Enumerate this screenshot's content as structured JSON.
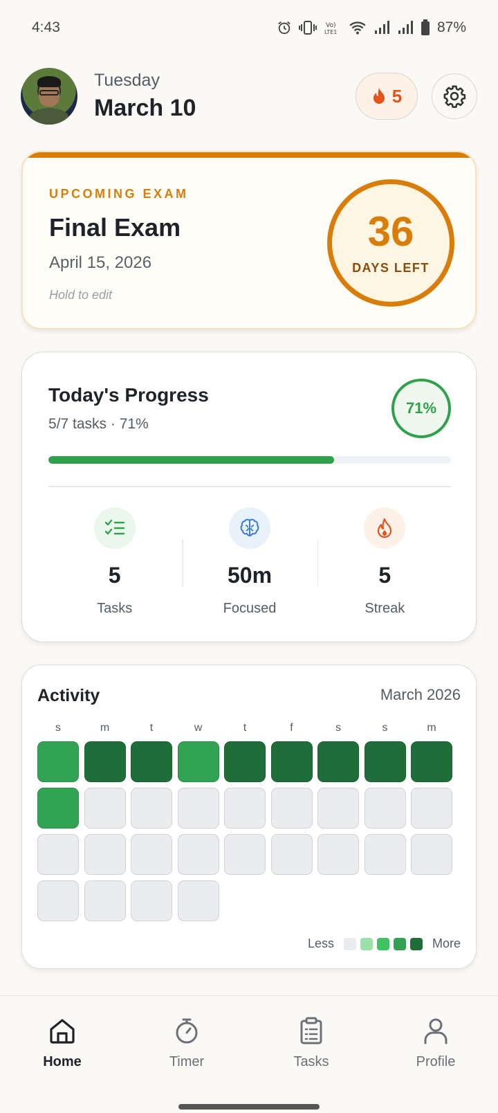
{
  "status_bar": {
    "time": "4:43",
    "battery": "87%",
    "icons": [
      "alarm-icon",
      "vibrate-icon",
      "volte-icon",
      "wifi-icon",
      "signal-icon",
      "signal-icon",
      "battery-icon"
    ]
  },
  "header": {
    "weekday": "Tuesday",
    "date": "March 10",
    "streak_count": "5",
    "streak_icon": "flame-icon",
    "settings_icon": "gear-icon"
  },
  "exam": {
    "label": "UPCOMING EXAM",
    "title": "Final Exam",
    "date": "April 15, 2026",
    "hint": "Hold to edit",
    "days_left": "36",
    "days_label": "DAYS LEFT",
    "accent": "#d97d0a"
  },
  "progress": {
    "title": "Today's Progress",
    "subtitle": "5/7 tasks · 71%",
    "percent_label": "71%",
    "percent": 71,
    "accent": "#2fa14a",
    "stats": [
      {
        "value": "5",
        "label": "Tasks",
        "icon": "checklist-icon"
      },
      {
        "value": "50m",
        "label": "Focused",
        "icon": "brain-icon"
      },
      {
        "value": "5",
        "label": "Streak",
        "icon": "flame-icon"
      }
    ]
  },
  "activity": {
    "title": "Activity",
    "month": "March 2026",
    "weekdays": [
      "s",
      "m",
      "t",
      "w",
      "t",
      "f",
      "s",
      "s",
      "m"
    ],
    "levels": [
      3,
      4,
      4,
      3,
      4,
      4,
      4,
      4,
      4,
      3,
      0,
      0,
      0,
      0,
      0,
      0,
      0,
      0,
      0,
      0,
      0,
      0,
      0,
      0,
      0,
      0,
      0,
      0,
      0,
      0,
      0
    ],
    "legend_less": "Less",
    "legend_more": "More",
    "legend_colors": [
      "#ebecef",
      "#9be0a8",
      "#40c463",
      "#31a352",
      "#1f6e39"
    ]
  },
  "nav": {
    "items": [
      {
        "label": "Home",
        "icon": "home-icon",
        "active": true
      },
      {
        "label": "Timer",
        "icon": "timer-icon",
        "active": false
      },
      {
        "label": "Tasks",
        "icon": "clipboard-icon",
        "active": false
      },
      {
        "label": "Profile",
        "icon": "person-icon",
        "active": false
      }
    ]
  }
}
